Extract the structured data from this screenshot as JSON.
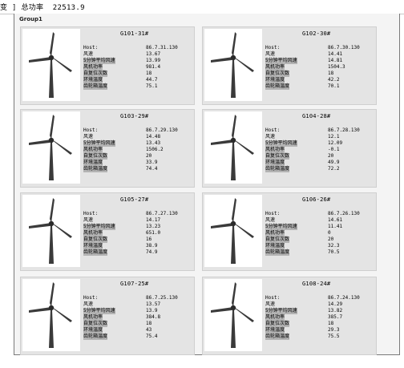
{
  "topbar": {
    "text": "变 ] 总功率  22513.9"
  },
  "group": {
    "title": "Group1"
  },
  "labels": {
    "host": "Host:",
    "wind_speed": "风速",
    "avg_wind_speed": "5分钟平均风速",
    "power": "风机功率",
    "yaw_count": "自复位次数",
    "ambient_temp": "环境温度",
    "gearbox_temp": "齿轮箱温度"
  },
  "turbines": [
    {
      "name": "G101-31#",
      "host": "86.7.31.130",
      "wind_speed": "13.67",
      "avg_wind_speed": "13.99",
      "power": "981.4",
      "yaw_count": "18",
      "ambient_temp": "44.7",
      "gearbox_temp": "75.1"
    },
    {
      "name": "G102-30#",
      "host": "86.7.30.130",
      "wind_speed": "14.41",
      "avg_wind_speed": "14.81",
      "power": "1504.3",
      "yaw_count": "18",
      "ambient_temp": "42.2",
      "gearbox_temp": "70.1"
    },
    {
      "name": "G103-29#",
      "host": "86.7.29.130",
      "wind_speed": "14.48",
      "avg_wind_speed": "13.43",
      "power": "1506.2",
      "yaw_count": "20",
      "ambient_temp": "33.9",
      "gearbox_temp": "74.4"
    },
    {
      "name": "G104-28#",
      "host": "86.7.28.130",
      "wind_speed": "12.1",
      "avg_wind_speed": "12.09",
      "power": "-0.1",
      "yaw_count": "20",
      "ambient_temp": "49.9",
      "gearbox_temp": "72.2"
    },
    {
      "name": "G105-27#",
      "host": "86.7.27.130",
      "wind_speed": "14.17",
      "avg_wind_speed": "13.23",
      "power": "651.0",
      "yaw_count": "16",
      "ambient_temp": "38.9",
      "gearbox_temp": "74.9"
    },
    {
      "name": "G106-26#",
      "host": "86.7.26.130",
      "wind_speed": "14.61",
      "avg_wind_speed": "11.41",
      "power": "0",
      "yaw_count": "20",
      "ambient_temp": "32.3",
      "gearbox_temp": "70.5"
    },
    {
      "name": "G107-25#",
      "host": "86.7.25.130",
      "wind_speed": "13.57",
      "avg_wind_speed": "13.9",
      "power": "384.8",
      "yaw_count": "18",
      "ambient_temp": "43",
      "gearbox_temp": "75.4"
    },
    {
      "name": "G108-24#",
      "host": "86.7.24.130",
      "wind_speed": "14.29",
      "avg_wind_speed": "13.82",
      "power": "385.7",
      "yaw_count": "18",
      "ambient_temp": "29.3",
      "gearbox_temp": "75.5"
    }
  ],
  "colors": {
    "panel_bg": "#e4e4e4",
    "frame_bg": "#f4f4f4",
    "turbine": "#3a3a3a",
    "highlight": "#b4b4b4"
  },
  "icon": "wind-turbine-icon"
}
